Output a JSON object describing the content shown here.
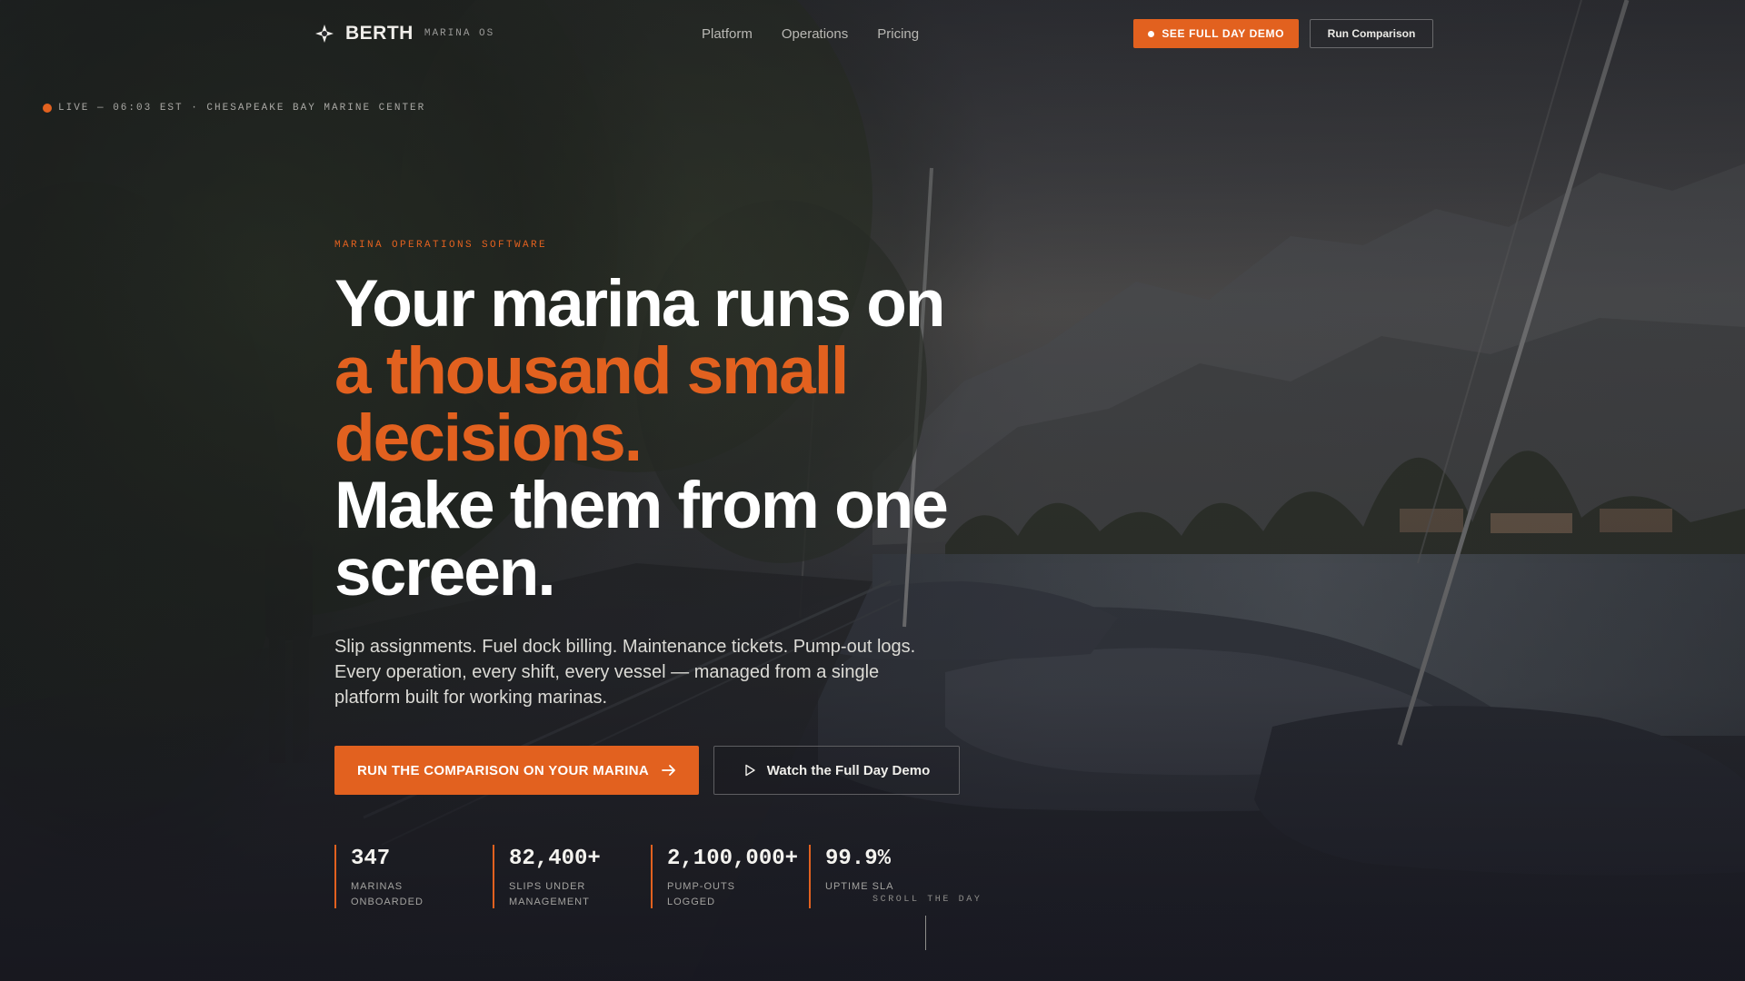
{
  "nav": {
    "brand_name": "BERTH",
    "brand_sub": "MARINA OS",
    "links": [
      "Platform",
      "Operations",
      "Pricing"
    ],
    "cta_label": "SEE FULL DAY DEMO",
    "secondary_label": "Run Comparison"
  },
  "status": {
    "live_text": "LIVE — 06:03 EST · CHESAPEAKE BAY MARINE CENTER"
  },
  "hero": {
    "eyebrow": "MARINA OPERATIONS SOFTWARE",
    "headline_line1": "Your marina runs on",
    "headline_accent": "a thousand small decisions.",
    "headline_line3": "Make them from one screen.",
    "lead": "Slip assignments. Fuel dock billing. Maintenance tickets. Pump-out logs. Every operation, every shift, every vessel — managed from a single platform built for working marinas.",
    "primary_cta": "RUN THE COMPARISON ON YOUR MARINA",
    "secondary_cta": "Watch the Full Day Demo"
  },
  "stats": [
    {
      "value": "347",
      "label": "MARINAS ONBOARDED"
    },
    {
      "value": "82,400+",
      "label": "SLIPS UNDER MANAGEMENT"
    },
    {
      "value": "2,100,000+",
      "label": "PUMP-OUTS LOGGED"
    },
    {
      "value": "99.9%",
      "label": "UPTIME SLA"
    }
  ],
  "scroll_hint": "SCROLL THE DAY",
  "colors": {
    "accent": "#e2611f",
    "text_primary": "#ffffff",
    "text_muted": "#a4a3a0",
    "background": "#1c1d22"
  },
  "icons": {
    "brand": "compass-star-icon",
    "live": "live-dot-icon",
    "cta_arrow": "arrow-right-icon",
    "play": "play-icon"
  }
}
